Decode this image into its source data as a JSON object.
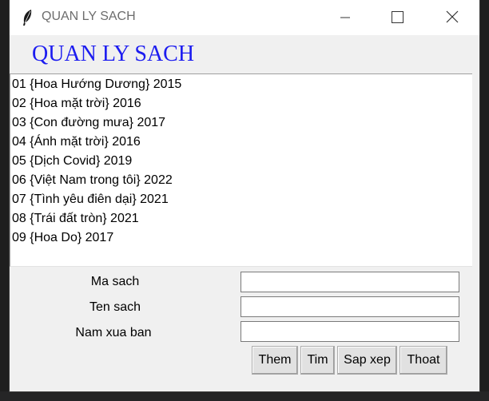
{
  "window": {
    "title": "QUAN LY SACH"
  },
  "app": {
    "heading": "QUAN LY SACH"
  },
  "books": [
    "01 {Hoa Hướng Dương} 2015",
    "02 {Hoa mặt trời} 2016",
    "03 {Con đường mưa} 2017",
    "04 {Ánh mặt trời} 2016",
    "05 {Dịch Covid} 2019",
    "06 {Việt Nam trong tôi} 2022",
    "07 {Tình yêu điên dại} 2021",
    "08 {Trái đất tròn} 2021",
    "09 {Hoa Do} 2017"
  ],
  "form": {
    "ma_sach_label": "Ma sach",
    "ma_sach_value": "",
    "ten_sach_label": "Ten sach",
    "ten_sach_value": "",
    "nam_xua_ban_label": "Nam xua ban",
    "nam_xua_ban_value": ""
  },
  "buttons": {
    "them": "Them",
    "tim": "Tim",
    "sap_xep": "Sap xep",
    "thoat": "Thoat"
  },
  "colors": {
    "heading": "#1c1cf0",
    "window_bg": "#f0f0f0",
    "titlebar_bg": "#ffffff"
  },
  "icons": [
    "feather-icon",
    "minimize-icon",
    "maximize-icon",
    "close-icon"
  ]
}
